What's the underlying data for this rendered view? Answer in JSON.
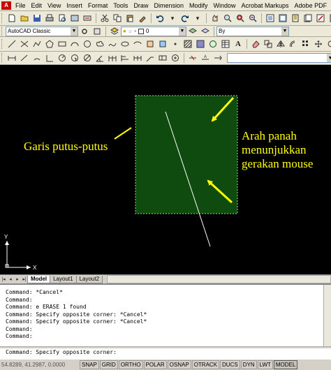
{
  "menu": {
    "items": [
      "File",
      "Edit",
      "View",
      "Insert",
      "Format",
      "Tools",
      "Draw",
      "Dimension",
      "Modify",
      "Window",
      "Acrobat Markups",
      "Adobe PDF"
    ]
  },
  "toolbar": {
    "workspace": "AutoCAD Classic",
    "layer": "0",
    "bylayer": "By"
  },
  "drawing": {
    "label_dashed": "Garis putus-putus",
    "label_arrow_line1": "Arah panah",
    "label_arrow_line2": "menunjukkan",
    "label_arrow_line3": "gerakan mouse",
    "ucs_x": "X",
    "ucs_y": "Y",
    "colors": {
      "canvas": "#000000",
      "selection_fill": "#0f4a0f",
      "selection_border": "#9fd49f",
      "annotation": "#ffff00"
    }
  },
  "tabs": {
    "items": [
      "Model",
      "Layout1",
      "Layout2"
    ]
  },
  "command": {
    "history": [
      "Command: *Cancel*",
      "Command:",
      "Command: e ERASE 1 found",
      "Command: Specify opposite corner: *Cancel*",
      "Command: Specify opposite corner: *Cancel*",
      "Command:",
      "Command:"
    ],
    "current": "Command: Specify opposite corner:"
  },
  "status": {
    "coords": "54.8289, 41.2987, 0.0000",
    "buttons": [
      "SNAP",
      "GRID",
      "ORTHO",
      "POLAR",
      "OSNAP",
      "OTRACK",
      "DUCS",
      "DYN",
      "LWT",
      "MODEL"
    ]
  }
}
